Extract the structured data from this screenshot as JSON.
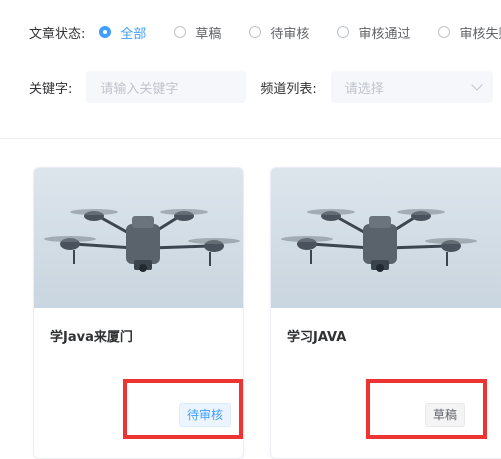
{
  "filter": {
    "status_label": "文章状态:",
    "status_options": [
      {
        "label": "全部",
        "checked": true
      },
      {
        "label": "草稿",
        "checked": false
      },
      {
        "label": "待审核",
        "checked": false
      },
      {
        "label": "审核通过",
        "checked": false
      },
      {
        "label": "审核失败",
        "checked": false
      }
    ],
    "keyword_label": "关键字:",
    "keyword_placeholder": "请输入关键字",
    "channel_label": "频道列表:",
    "channel_placeholder": "请选择"
  },
  "cards": [
    {
      "title": "学Java来厦门",
      "status_tag": "待审核",
      "image_icon": "drone-image"
    },
    {
      "title": "学习JAVA",
      "status_tag": "草稿",
      "image_icon": "drone-image"
    }
  ],
  "colors": {
    "accent": "#409eff",
    "highlight": "#ee3333",
    "image_bg": "#d3dde6"
  }
}
